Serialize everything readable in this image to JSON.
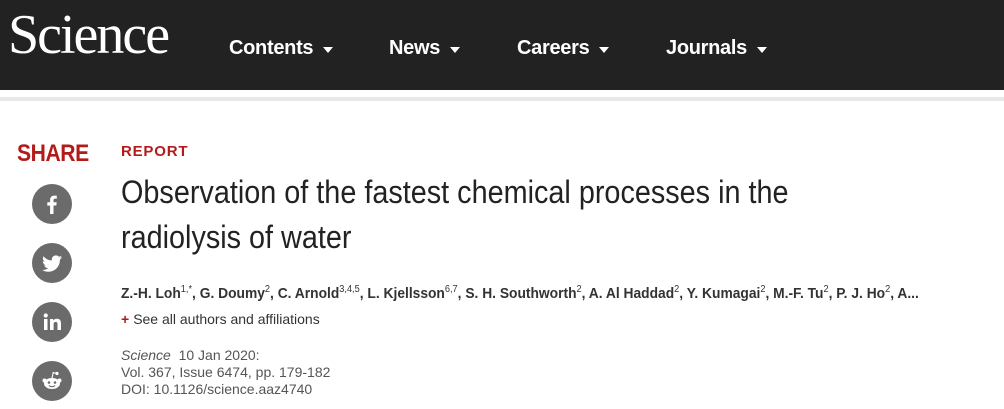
{
  "header": {
    "logo": "Science",
    "nav": [
      {
        "label": "Contents"
      },
      {
        "label": "News"
      },
      {
        "label": "Careers"
      },
      {
        "label": "Journals"
      }
    ]
  },
  "share": {
    "label": "SHARE",
    "buttons": [
      "facebook-icon",
      "twitter-icon",
      "linkedin-icon",
      "reddit-icon"
    ]
  },
  "article": {
    "type": "REPORT",
    "title_line1": "Observation of the fastest chemical processes in the",
    "title_line2": "radiolysis of water",
    "authors": [
      {
        "name": "Z.-H. Loh",
        "sup": "1,*"
      },
      {
        "name": "G. Doumy",
        "sup": "2"
      },
      {
        "name": "C. Arnold",
        "sup": "3,4,5"
      },
      {
        "name": "L. Kjellsson",
        "sup": "6,7"
      },
      {
        "name": "S. H. Southworth",
        "sup": "2"
      },
      {
        "name": "A. Al Haddad",
        "sup": "2"
      },
      {
        "name": "Y. Kumagai",
        "sup": "2"
      },
      {
        "name": "M.-F. Tu",
        "sup": "2"
      },
      {
        "name": "P. J. Ho",
        "sup": "2"
      },
      {
        "name": "A...",
        "sup": ""
      }
    ],
    "see_all": "See all authors and affiliations",
    "see_all_plus": "+",
    "journal": "Science",
    "date": "10 Jan 2020:",
    "volume": "Vol. 367, Issue 6474, pp. 179-182",
    "doi": "DOI: 10.1126/science.aaz4740"
  },
  "colors": {
    "nav_bg": "#222222",
    "accent": "#b31b1b",
    "share_icon_bg": "#6b6b6b"
  }
}
